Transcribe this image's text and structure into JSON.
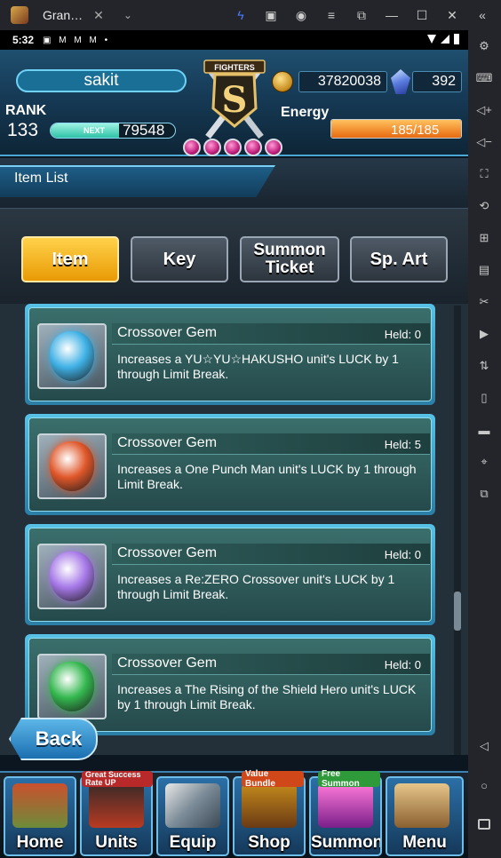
{
  "window": {
    "tab_title": "Gran…",
    "tab_close": "✕",
    "tab_more": "⌄",
    "toolbar_icons": [
      "bolt-icon",
      "gift-icon",
      "account-icon",
      "menu-icon",
      "popout-icon",
      "minimize-icon",
      "maximize-icon",
      "close-icon",
      "collapse-icon"
    ]
  },
  "status_bar": {
    "time": "5:32",
    "notifications": "▣ M M M •"
  },
  "header": {
    "player_name": "sakit",
    "coins": "37820038",
    "gems": "392",
    "rank_label": "RANK",
    "rank": "133",
    "next_label": "NEXT",
    "next_exp": "79548",
    "exp_fraction": 0.55,
    "energy_label": "Energy",
    "energy": "185/185",
    "energy_fraction": 1.0,
    "logo_text": "FIGHTERS",
    "logo_letter": "S"
  },
  "page": {
    "title": "Item List"
  },
  "tabs": [
    {
      "label": "Item",
      "active": true
    },
    {
      "label": "Key",
      "active": false
    },
    {
      "label": "Summon Ticket",
      "active": false
    },
    {
      "label": "Sp. Art",
      "active": false
    }
  ],
  "items": [
    {
      "title": "Crossover Gem",
      "held": "Held: 0",
      "desc": "Increases a YU☆YU☆HAKUSHO unit's LUCK by 1 through Limit Break.",
      "gem_color": "#3fb1e6"
    },
    {
      "title": "Crossover Gem",
      "held": "Held: 5",
      "desc": "Increases a One Punch Man unit's LUCK by 1 through Limit Break.",
      "gem_color": "#e0572a"
    },
    {
      "title": "Crossover Gem",
      "held": "Held: 0",
      "desc": "Increases a Re:ZERO Crossover unit's LUCK by 1 through Limit Break.",
      "gem_color": "#a678e8"
    },
    {
      "title": "Crossover Gem",
      "held": "Held: 0",
      "desc": "Increases a The Rising of the Shield Hero unit's LUCK by 1 through Limit Break.",
      "gem_color": "#34b84f"
    }
  ],
  "back_label": "Back",
  "nav": [
    {
      "label": "Home",
      "badge": ""
    },
    {
      "label": "Units",
      "badge": "Great Success Rate UP"
    },
    {
      "label": "Equip",
      "badge": ""
    },
    {
      "label": "Shop",
      "badge": "Value Bundle"
    },
    {
      "label": "Summon",
      "badge": "Free Summon"
    },
    {
      "label": "Menu",
      "badge": ""
    }
  ]
}
